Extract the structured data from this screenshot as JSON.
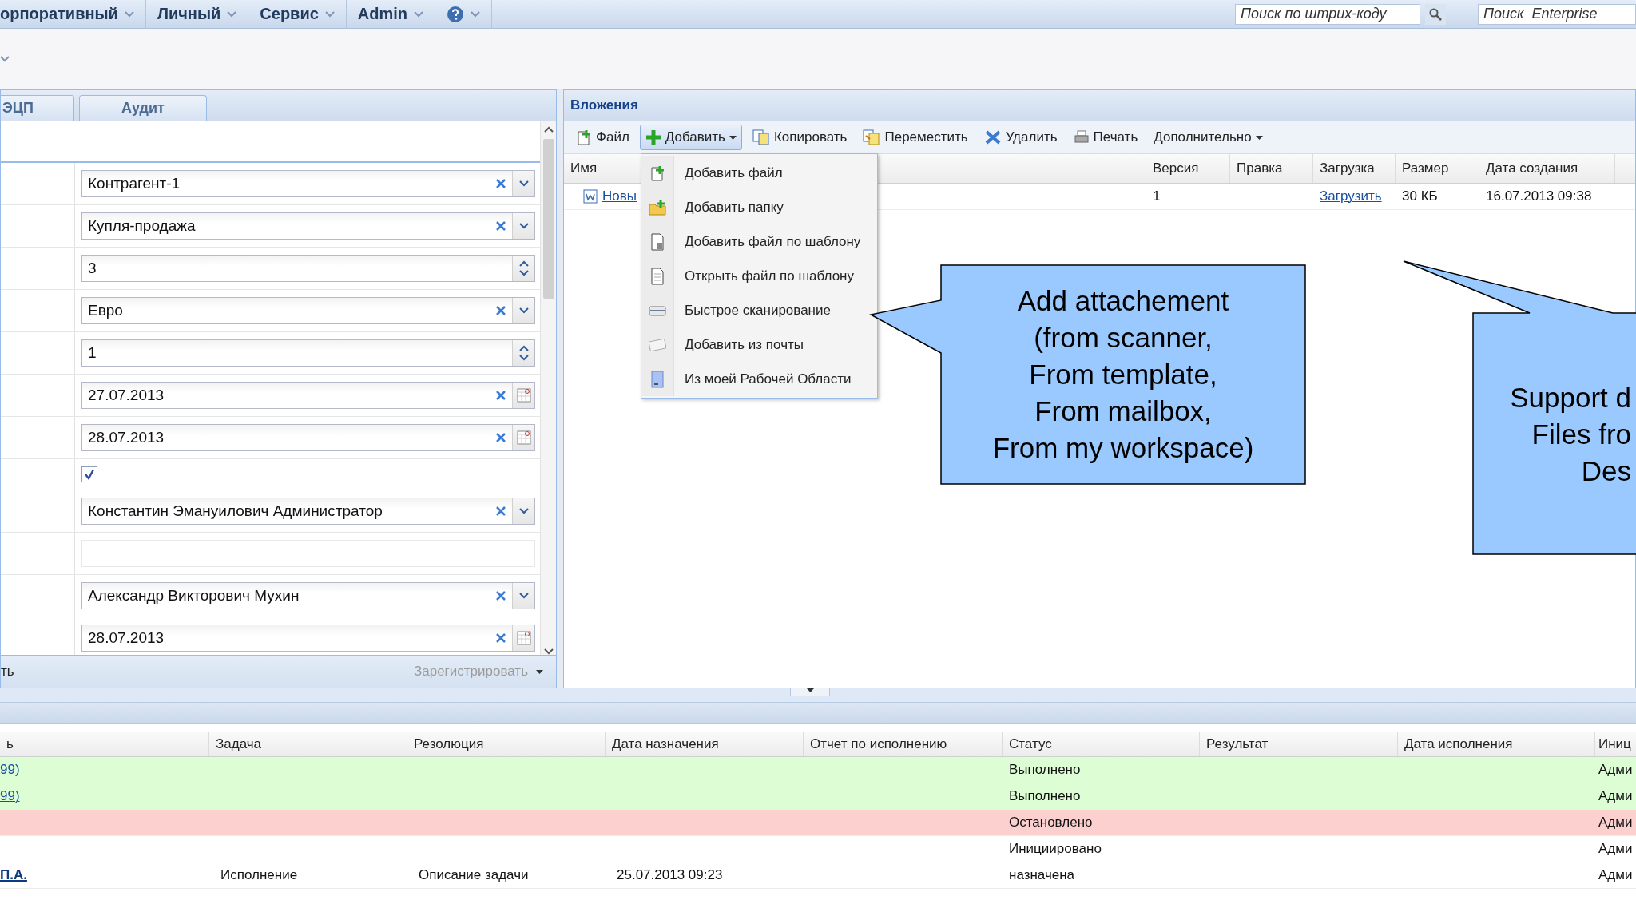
{
  "menu_bar": {
    "items": [
      {
        "label": "орпоративный"
      },
      {
        "label": "Личный"
      },
      {
        "label": "Сервис"
      },
      {
        "label": "Admin"
      }
    ],
    "barcode_search": {
      "placeholder": "Поиск по штрих-коду"
    },
    "enterprise_search": {
      "placeholder": "Поиск  Enterprise"
    }
  },
  "form_panel": {
    "tabs": [
      {
        "label": "ЭЦП"
      },
      {
        "label": "Аудит"
      }
    ],
    "fields": [
      {
        "kind": "combo",
        "value": "Контрагент-1"
      },
      {
        "kind": "combo",
        "value": "Купля-продажа"
      },
      {
        "kind": "spinner",
        "value": "3"
      },
      {
        "kind": "combo",
        "value": "Евро"
      },
      {
        "kind": "spinner",
        "value": "1"
      },
      {
        "kind": "date",
        "value": "27.07.2013"
      },
      {
        "kind": "date",
        "value": "28.07.2013"
      },
      {
        "kind": "checkbox",
        "checked": true
      },
      {
        "kind": "combo",
        "value": "Константин Эмануилович Администратор"
      },
      {
        "kind": "empty"
      },
      {
        "kind": "combo",
        "value": "Александр Викторович Мухин"
      },
      {
        "kind": "date",
        "value": "28.07.2013"
      }
    ],
    "footer": {
      "left": "ть",
      "action": "Зарегистрировать",
      "action_disabled": true
    }
  },
  "attachments": {
    "title": "Вложения",
    "toolbar": [
      {
        "label": "Файл",
        "selected": false,
        "dropdown": false
      },
      {
        "label": "Добавить",
        "selected": true,
        "dropdown": true
      },
      {
        "label": "Копировать",
        "selected": false,
        "dropdown": false
      },
      {
        "label": "Переместить",
        "selected": false,
        "dropdown": false
      },
      {
        "label": "Удалить",
        "selected": false,
        "dropdown": false
      },
      {
        "label": "Печать",
        "selected": false,
        "dropdown": false
      },
      {
        "label": "Дополнительно",
        "selected": false,
        "dropdown": true
      }
    ],
    "columns": [
      "Имя",
      "Версия",
      "Правка",
      "Загрузка",
      "Размер",
      "Дата создания"
    ],
    "rows": [
      {
        "name": "Новы",
        "version": "1",
        "download": "Загрузить",
        "size": "30 КБ",
        "created": "16.07.2013 09:38"
      }
    ]
  },
  "add_menu": {
    "items": [
      "Добавить файл",
      "Добавить папку",
      "Добавить файл по шаблону",
      "Открыть файл по шаблону",
      "Быстрое сканирование",
      "Добавить из почты",
      "Из моей Рабочей Области"
    ]
  },
  "callouts": [
    {
      "lines": [
        "Add attachement",
        "(from scanner,",
        "From template,",
        "From mailbox,",
        "From my workspace)"
      ]
    },
    {
      "lines": [
        "Support d",
        "Files fro",
        "Des"
      ]
    }
  ],
  "tasks": {
    "columns": [
      "ь",
      "Задача",
      "Резолюция",
      "Дата назначения",
      "Отчет по исполнению",
      "Статус",
      "Результат",
      "Дата исполнения",
      "Иниц"
    ],
    "rows": [
      {
        "color": "#ddfdd4",
        "bold": false,
        "column_1": "99)",
        "status": "Выполнено",
        "column_9": "Адми"
      },
      {
        "color": "#ddfdd4",
        "bold": false,
        "column_1": "99)",
        "status": "Выполнено",
        "column_9": "Адми"
      },
      {
        "color": "#fdd0d0",
        "status": "Остановлено",
        "column_9": "Адми"
      },
      {
        "color": "#ffffff",
        "status": "Инициировано",
        "column_9": "Адми"
      },
      {
        "color": "#ffffff",
        "bold": true,
        "column_1": "П.А.",
        "task": "Исполнение",
        "resolution": "Описание задачи",
        "assigned_date": "25.07.2013 09:23",
        "status": "назначена",
        "column_9": "Адми"
      }
    ]
  }
}
